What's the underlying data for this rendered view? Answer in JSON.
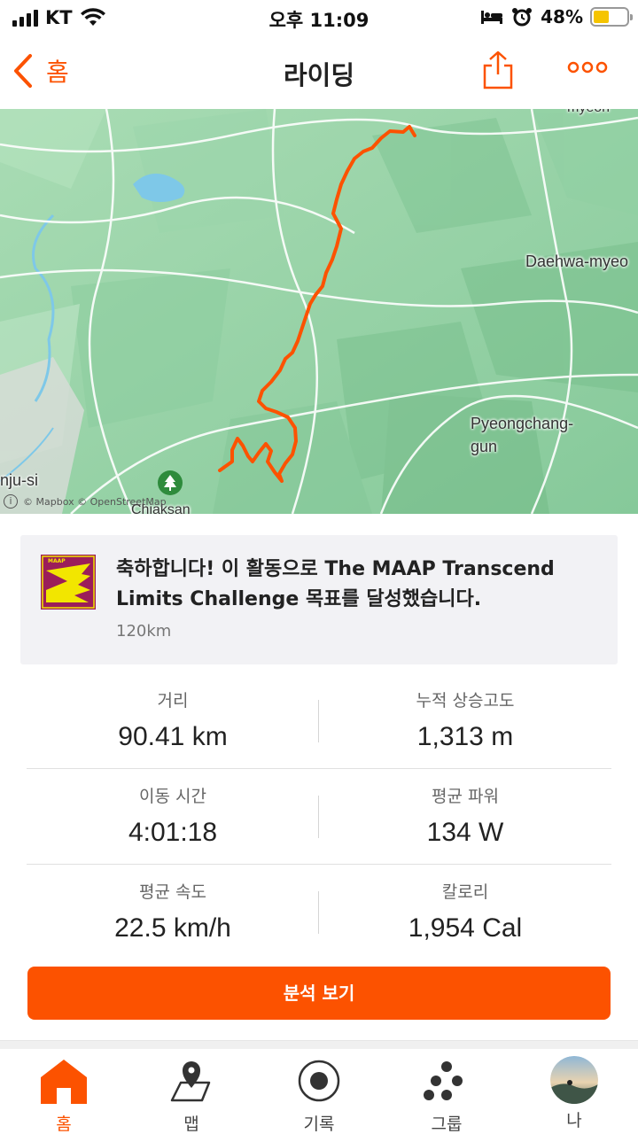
{
  "status_bar": {
    "carrier": "KT",
    "time": "오후 11:09",
    "battery_percent": "48%",
    "battery_level": 0.48
  },
  "nav": {
    "back_label": "홈",
    "title": "라이딩"
  },
  "map": {
    "labels": {
      "daehwa": "Daehwa-myeo",
      "pyeongchang": "Pyeongchang-\ngun",
      "wonju": "nju-si",
      "chiaksan": "Chiaksan",
      "top": "myeon"
    },
    "attribution": "© Mapbox © OpenStreetMap",
    "route_color": "#fc5200"
  },
  "achievement": {
    "message": "축하합니다! 이 활동으로 The MAAP Transcend Limits Challenge 목표를 달성했습니다.",
    "goal": "120km"
  },
  "stats": [
    {
      "label": "거리",
      "value": "90.41 km"
    },
    {
      "label": "누적 상승고도",
      "value": "1,313 m"
    },
    {
      "label": "이동 시간",
      "value": "4:01:18"
    },
    {
      "label": "평균 파워",
      "value": "134 W"
    },
    {
      "label": "평균 속도",
      "value": "22.5 km/h"
    },
    {
      "label": "칼로리",
      "value": "1,954 Cal"
    }
  ],
  "analysis_button": "분석 보기",
  "tabs": [
    {
      "label": "홈",
      "icon": "home-icon",
      "active": true
    },
    {
      "label": "맵",
      "icon": "map-icon",
      "active": false
    },
    {
      "label": "기록",
      "icon": "record-icon",
      "active": false
    },
    {
      "label": "그룹",
      "icon": "groups-icon",
      "active": false
    },
    {
      "label": "나",
      "icon": "avatar",
      "active": false
    }
  ],
  "colors": {
    "accent": "#fc5200",
    "map_green": "#93d3a4"
  }
}
